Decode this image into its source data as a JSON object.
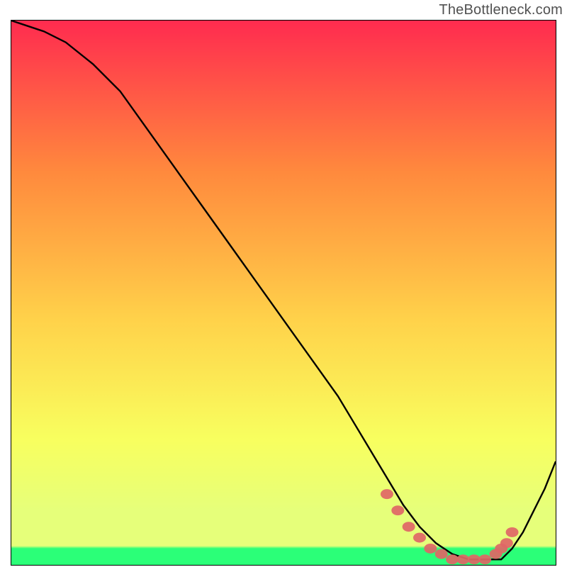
{
  "watermark": "TheBottleneck.com",
  "colors": {
    "gradient_top": "#ff2b4f",
    "gradient_mid1": "#ff8a3d",
    "gradient_mid2": "#ffd24a",
    "gradient_mid3": "#f8ff5f",
    "gradient_mid4": "#e6ff7a",
    "gradient_bottom_band": "#2bff78",
    "curve": "#000000",
    "marker": "#e06666"
  },
  "chart_data": {
    "type": "line",
    "title": "",
    "xlabel": "",
    "ylabel": "",
    "xlim": [
      0,
      100
    ],
    "ylim": [
      0,
      100
    ],
    "grid": false,
    "legend": null,
    "annotations": [],
    "series": [
      {
        "name": "bottleneck-curve",
        "x": [
          0,
          3,
          6,
          10,
          15,
          20,
          25,
          30,
          35,
          40,
          45,
          50,
          55,
          60,
          63,
          66,
          69,
          72,
          75,
          78,
          81,
          84,
          86,
          88,
          90,
          92,
          94,
          96,
          98,
          100
        ],
        "y": [
          100,
          99,
          98,
          96,
          92,
          87,
          80,
          73,
          66,
          59,
          52,
          45,
          38,
          31,
          26,
          21,
          16,
          11,
          7,
          4,
          2,
          1,
          1,
          1,
          1,
          3,
          6,
          10,
          14,
          19
        ]
      }
    ],
    "markers": {
      "name": "valley-markers",
      "x": [
        69,
        71,
        73,
        75,
        77,
        79,
        81,
        83,
        85,
        87,
        89,
        90,
        91,
        92
      ],
      "y": [
        13,
        10,
        7,
        5,
        3,
        2,
        1,
        1,
        1,
        1,
        2,
        3,
        4,
        6
      ]
    }
  }
}
